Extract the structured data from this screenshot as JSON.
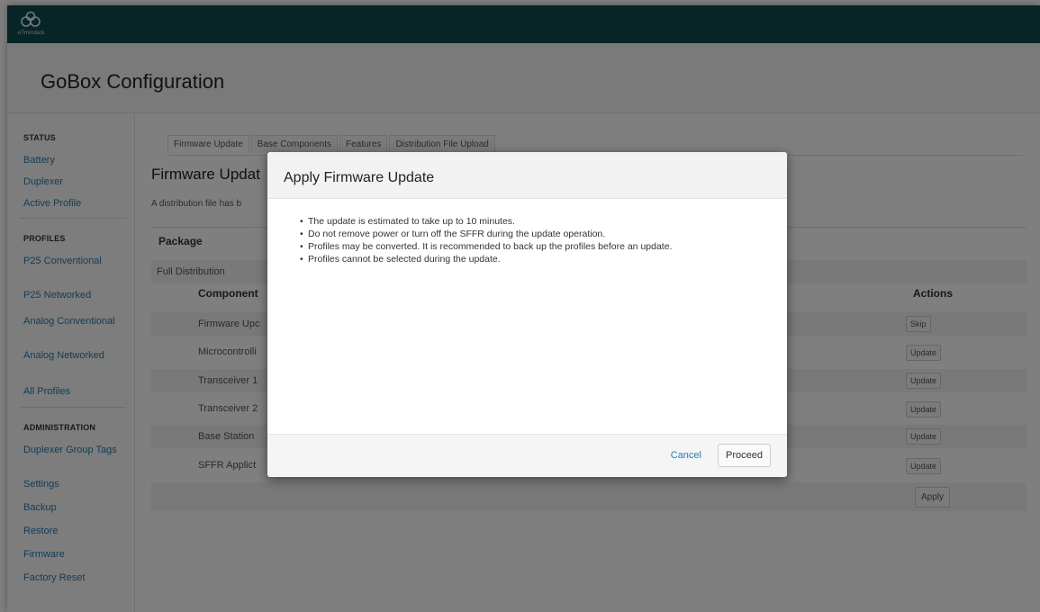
{
  "brand": {
    "logo_text": "eTrnnstack"
  },
  "header": {
    "title": "GoBox Configuration"
  },
  "sidebar": {
    "sections": [
      {
        "title": "STATUS",
        "items": [
          "Battery",
          "Duplexer",
          "Active Profile"
        ]
      },
      {
        "title": "PROFILES",
        "items": [
          "P25 Conventional",
          "P25 Networked",
          "Analog Conventional",
          "Analog Networked",
          "All Profiles"
        ]
      },
      {
        "title": "ADMINISTRATION",
        "items": [
          "Duplexer Group Tags",
          "Settings",
          "Backup",
          "Restore",
          "Firmware",
          "Factory Reset"
        ]
      }
    ]
  },
  "tabs": [
    "Firmware Update",
    "Base Components",
    "Features",
    "Distribution File Upload"
  ],
  "main": {
    "title": "Firmware Updat",
    "note": "A distribution file has b",
    "package_header": "Package",
    "package_row": "Full Distribution",
    "component_header": "Component",
    "actions_header": "Actions",
    "components": [
      {
        "name": "Firmware Upc",
        "action": "Skip"
      },
      {
        "name": "Microcontrolli",
        "action": "Update"
      },
      {
        "name": "Transceiver 1",
        "action": "Update"
      },
      {
        "name": "Transceiver 2",
        "action": "Update"
      },
      {
        "name": "Base Station",
        "action": "Update"
      },
      {
        "name": "SFFR Applict",
        "action": "Update"
      }
    ],
    "apply_label": "Apply"
  },
  "modal": {
    "title": "Apply Firmware Update",
    "bullets": [
      "The update is estimated to take up to 10 minutes.",
      "Do not remove power or turn off the SFFR during the update operation.",
      "Profiles may be converted. It is recommended to back up the profiles before an update.",
      "Profiles cannot be selected during the update."
    ],
    "cancel_label": "Cancel",
    "proceed_label": "Proceed"
  },
  "colors": {
    "topbar": "#0e4a4e",
    "link": "#2a7ab0"
  }
}
